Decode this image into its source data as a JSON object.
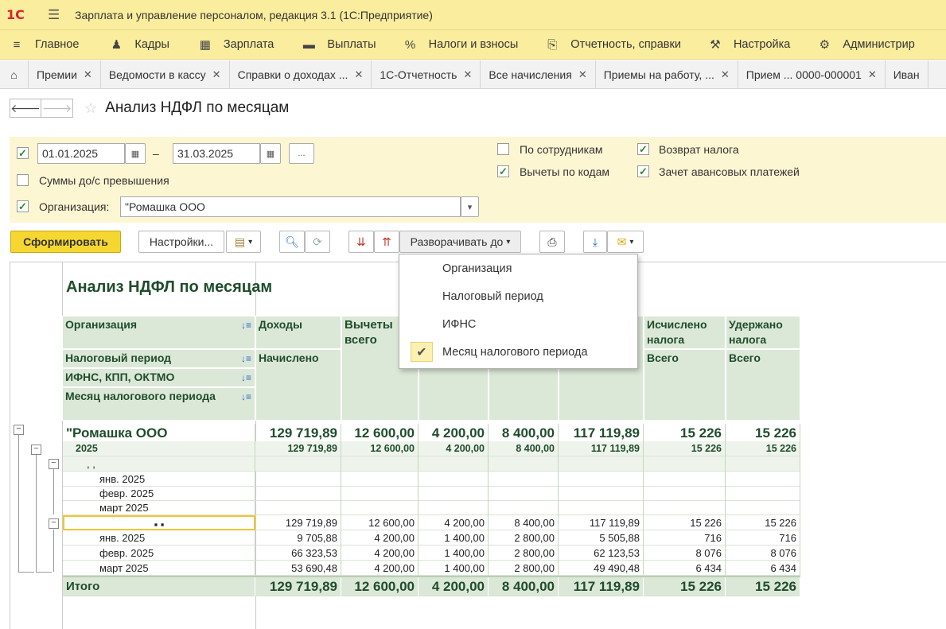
{
  "app": {
    "logo": "1С",
    "title": "Зарплата и управление персоналом, редакция 3.1  (1С:Предприятие)"
  },
  "menu": [
    {
      "label": "Главное",
      "icon": "menu-lines-icon"
    },
    {
      "label": "Кадры",
      "icon": "people-icon"
    },
    {
      "label": "Зарплата",
      "icon": "calculator-icon"
    },
    {
      "label": "Выплаты",
      "icon": "wallet-icon"
    },
    {
      "label": "Налоги и взносы",
      "icon": "percent-icon"
    },
    {
      "label": "Отчетность, справки",
      "icon": "documents-icon"
    },
    {
      "label": "Настройка",
      "icon": "wrench-icon"
    },
    {
      "label": "Администрир",
      "icon": "gear-icon"
    }
  ],
  "tabs": [
    {
      "label": "Премии"
    },
    {
      "label": "Ведомости в кассу"
    },
    {
      "label": "Справки о доходах ..."
    },
    {
      "label": "1С-Отчетность"
    },
    {
      "label": "Все начисления"
    },
    {
      "label": "Приемы на работу, ..."
    },
    {
      "label": "Прием ... 0000-000001"
    },
    {
      "label": "Иван"
    }
  ],
  "page": {
    "title": "Анализ НДФЛ по месяцам"
  },
  "filters": {
    "date_from": "01.01.2025",
    "date_to": "31.03.2025",
    "dash": "–",
    "period_button": "...",
    "sums_exceed_label": "Суммы до/с превышения",
    "org_label": "Организация:",
    "org_value": "\"Ромашка ООО",
    "by_employees_label": "По сотрудникам",
    "deductions_by_codes_label": "Вычеты по кодам",
    "tax_refund_label": "Возврат налога",
    "advance_offset_label": "Зачет авансовых платежей",
    "checked": {
      "period": true,
      "sums_exceed": false,
      "org": true,
      "by_employees": false,
      "deductions_by_codes": true,
      "tax_refund": true,
      "advance_offset": true
    }
  },
  "toolbar": {
    "generate": "Сформировать",
    "settings": "Настройки...",
    "expand_to": "Разворачивать до"
  },
  "dropdown": {
    "items": [
      "Организация",
      "Налоговый период",
      "ИФНС",
      "Месяц налогового периода"
    ],
    "selected_index": 3
  },
  "report": {
    "title": "Анализ НДФЛ по месяцам",
    "row_headers": [
      "Организация",
      "Налоговый период",
      "ИФНС, КПП, ОКТМО",
      "Месяц налогового периода"
    ],
    "col_headers": {
      "income": "Доходы",
      "income_sub": "Начислено",
      "deductions": "Вычеты всего",
      "calculated": "Исчислено налога",
      "calculated_sub": "Всего",
      "withheld": "Удержано налога",
      "withheld_sub": "Всего"
    },
    "rows": [
      {
        "level": 0,
        "label": "\"Ромашка ООО",
        "values": [
          "129 719,89",
          "12 600,00",
          "4 200,00",
          "8 400,00",
          "117 119,89",
          "15 226",
          "15 226"
        ]
      },
      {
        "level": 1,
        "label": "2025",
        "values": [
          "129 719,89",
          "12 600,00",
          "4 200,00",
          "8 400,00",
          "117 119,89",
          "15 226",
          "15 226"
        ]
      },
      {
        "level": 2,
        "label": ", ,",
        "values": [
          "",
          "",
          "",
          "",
          "",
          "",
          ""
        ]
      },
      {
        "level": 3,
        "label": "янв. 2025",
        "values": [
          "",
          "",
          "",
          "",
          "",
          "",
          ""
        ]
      },
      {
        "level": 3,
        "label": "февр. 2025",
        "values": [
          "",
          "",
          "",
          "",
          "",
          "",
          ""
        ]
      },
      {
        "level": 3,
        "label": "март 2025",
        "values": [
          "",
          "",
          "",
          "",
          "",
          "",
          ""
        ]
      },
      {
        "level": 2,
        "label": "▪ ▪",
        "values": [
          "129 719,89",
          "12 600,00",
          "4 200,00",
          "8 400,00",
          "117 119,89",
          "15 226",
          "15 226"
        ]
      },
      {
        "level": 3,
        "label": "янв. 2025",
        "values": [
          "9 705,88",
          "4 200,00",
          "1 400,00",
          "2 800,00",
          "5 505,88",
          "716",
          "716"
        ]
      },
      {
        "level": 3,
        "label": "февр. 2025",
        "values": [
          "66 323,53",
          "4 200,00",
          "1 400,00",
          "2 800,00",
          "62 123,53",
          "8 076",
          "8 076"
        ]
      },
      {
        "level": 3,
        "label": "март 2025",
        "values": [
          "53 690,48",
          "4 200,00",
          "1 400,00",
          "2 800,00",
          "49 490,48",
          "6 434",
          "6 434"
        ]
      }
    ],
    "total": {
      "label": "Итого",
      "values": [
        "129 719,89",
        "12 600,00",
        "4 200,00",
        "8 400,00",
        "117 119,89",
        "15 226",
        "15 226"
      ]
    }
  }
}
